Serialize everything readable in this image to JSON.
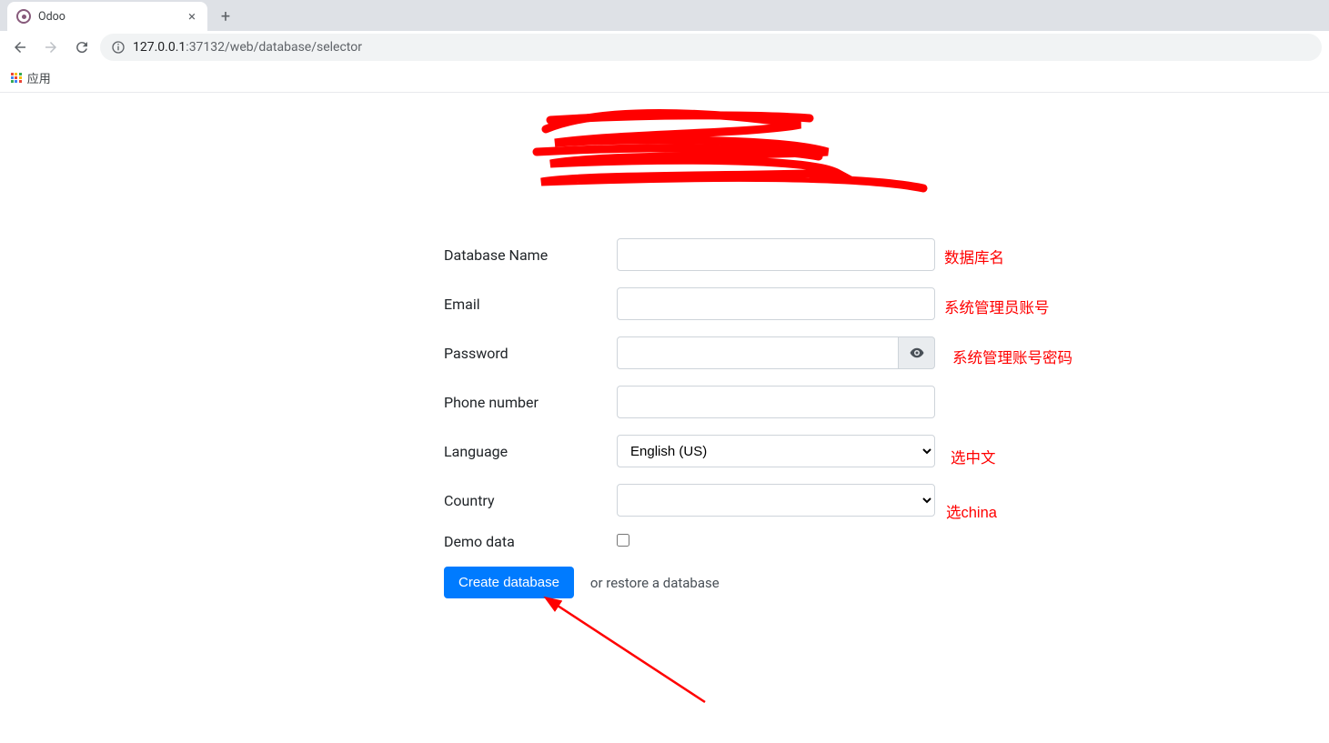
{
  "browser": {
    "tab_title": "Odoo",
    "url_host": "127.0.0.1",
    "url_port_path": ":37132/web/database/selector",
    "bookmark_apps": "应用"
  },
  "form": {
    "database_name_label": "Database Name",
    "email_label": "Email",
    "password_label": "Password",
    "phone_label": "Phone number",
    "language_label": "Language",
    "language_value": "English (US)",
    "country_label": "Country",
    "country_value": "",
    "demo_label": "Demo data",
    "create_button": "Create database",
    "restore_link": "or restore a database"
  },
  "annotations": {
    "db_name": "数据库名",
    "email": "系统管理员账号",
    "password": "系统管理账号密码",
    "language": "选中文",
    "country": "选china"
  }
}
